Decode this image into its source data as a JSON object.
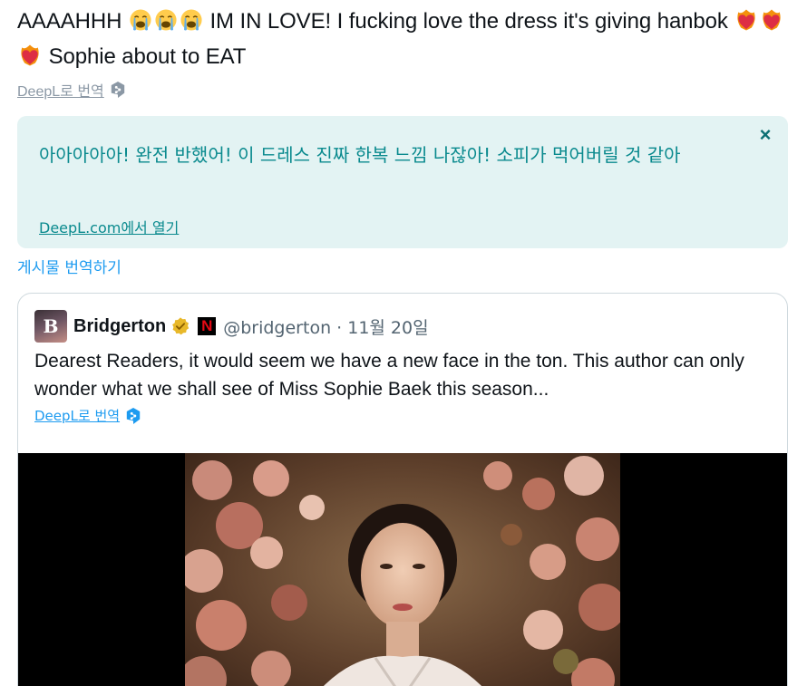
{
  "tweet": {
    "text_part1": "AAAAHHH",
    "text_part2": " IM IN LOVE! I fucking love the dress it's giving hanbok",
    "text_part3": " Sophie about to EAT",
    "emoji_crying": "loudly-crying-face-emoji",
    "emoji_heart": "heart-on-fire-emoji"
  },
  "deepl": {
    "translate_label": "DeepL로 번역",
    "badge_icon": "deepl-icon"
  },
  "translation": {
    "text": "아아아아아! 완전 반했어! 이 드레스 진짜 한복 느낌 나잖아! 소피가 먹어버릴 것 같아",
    "open_link": "DeepL.com에서 열기",
    "close_symbol": "×"
  },
  "translate_post_label": "게시물 번역하기",
  "quote": {
    "avatar_letter": "B",
    "name": "Bridgerton",
    "netflix_letter": "N",
    "handle": "@bridgerton",
    "separator": " · ",
    "date": "11월 20일",
    "text": "Dearest Readers, it would seem we have a new face in the ton. This author can only wonder what we shall see of Miss Sophie Baek this season...",
    "deepl_label": "DeepL로 번역"
  },
  "colors": {
    "teal_text": "#0a8a8e",
    "teal_bg": "#e3f3f3",
    "link_blue": "#1d9bf0",
    "gray": "#8b98a5",
    "verified_gold": "#e8b829"
  }
}
